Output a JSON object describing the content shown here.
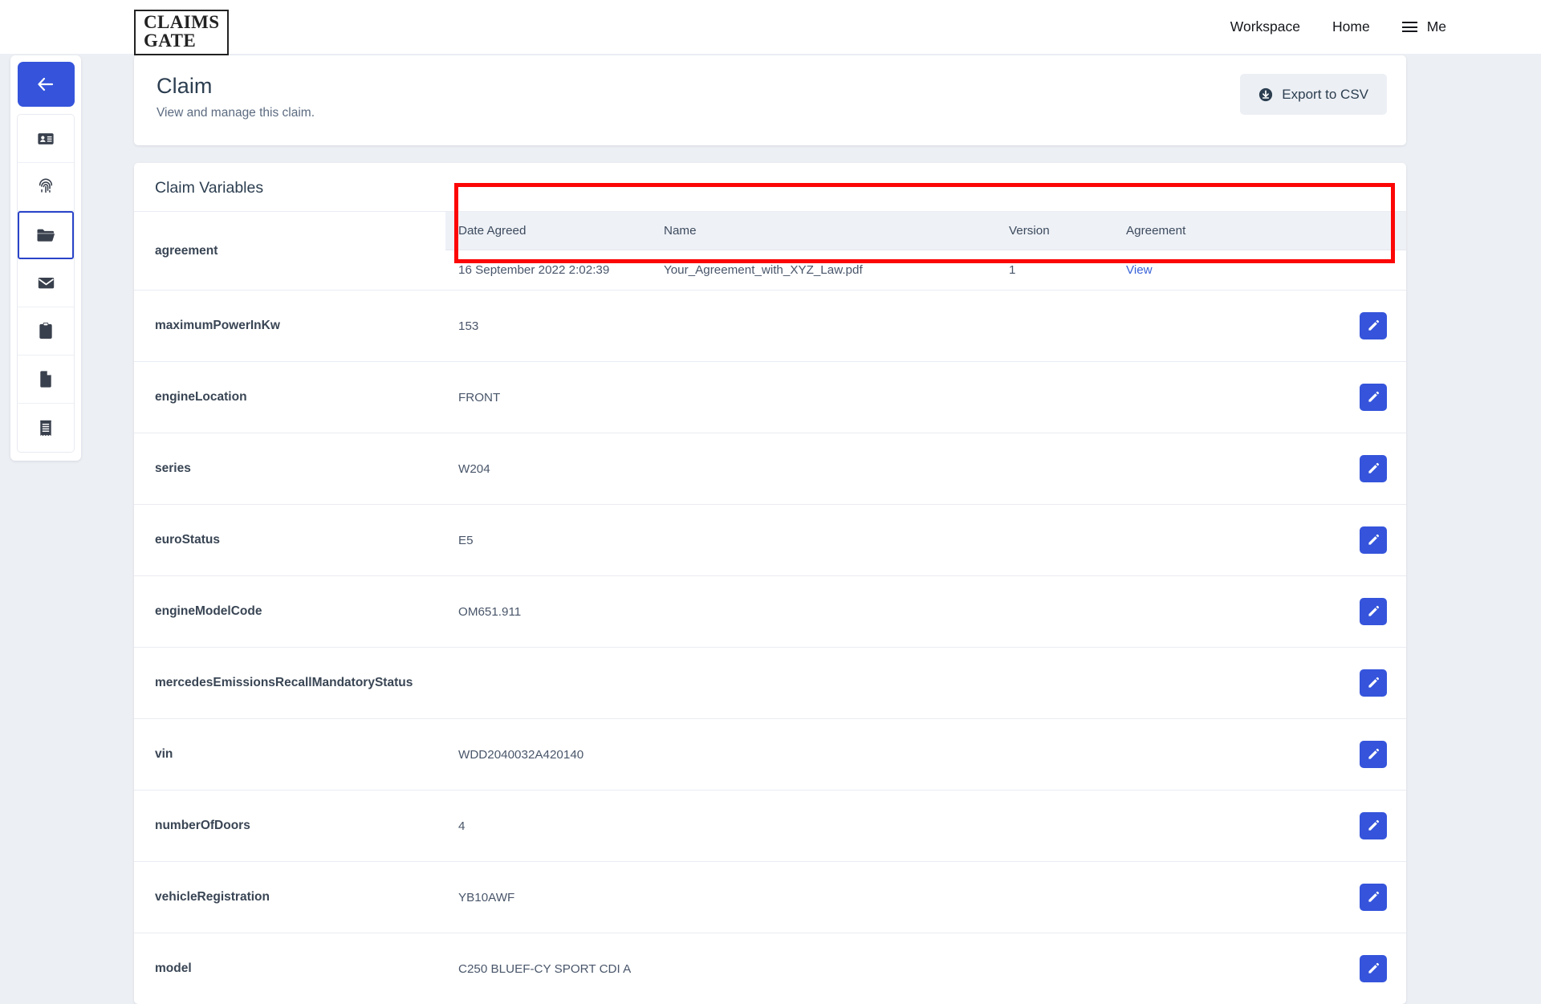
{
  "topbar": {
    "logo_line1": "CLAIMS",
    "logo_line2": "GATE",
    "nav": [
      {
        "label": "Workspace"
      },
      {
        "label": "Home"
      }
    ],
    "menu_label": "Me",
    "menu_icon": "hamburger-icon"
  },
  "sidebar": {
    "back_icon": "arrow-left-icon",
    "items": [
      {
        "icon": "id-card-icon",
        "name": "identity",
        "active": false
      },
      {
        "icon": "fingerprint-icon",
        "name": "biometrics",
        "active": false
      },
      {
        "icon": "folder-icon",
        "name": "files",
        "active": true
      },
      {
        "icon": "envelope-icon",
        "name": "messages",
        "active": false
      },
      {
        "icon": "clipboard-icon",
        "name": "tasks",
        "active": false
      },
      {
        "icon": "file-icon",
        "name": "documents",
        "active": false
      },
      {
        "icon": "receipt-icon",
        "name": "invoices",
        "active": false
      }
    ]
  },
  "header": {
    "title": "Claim",
    "subtitle": "View and manage this claim.",
    "export_label": "Export to CSV",
    "export_icon": "download-circle-icon"
  },
  "variables_section": {
    "title": "Claim Variables",
    "edit_icon": "pencil-icon",
    "agreement_row": {
      "key": "agreement",
      "columns": [
        "Date Agreed",
        "Name",
        "Version",
        "Agreement"
      ],
      "rows": [
        {
          "date_agreed": "16 September 2022 2:02:39",
          "name": "Your_Agreement_with_XYZ_Law.pdf",
          "version": "1",
          "agreement_link": "View"
        }
      ]
    },
    "rows": [
      {
        "key": "maximumPowerInKw",
        "value": "153"
      },
      {
        "key": "engineLocation",
        "value": "FRONT"
      },
      {
        "key": "series",
        "value": "W204"
      },
      {
        "key": "euroStatus",
        "value": "E5"
      },
      {
        "key": "engineModelCode",
        "value": "OM651.911"
      },
      {
        "key": "mercedesEmissionsRecallMandatoryStatus",
        "value": ""
      },
      {
        "key": "vin",
        "value": "WDD2040032A420140"
      },
      {
        "key": "numberOfDoors",
        "value": "4"
      },
      {
        "key": "vehicleRegistration",
        "value": "YB10AWF"
      },
      {
        "key": "model",
        "value": "C250 BLUEF-CY SPORT CDI A"
      }
    ]
  },
  "annotation": {
    "color": "#fc0606",
    "target": "agreement-table"
  }
}
